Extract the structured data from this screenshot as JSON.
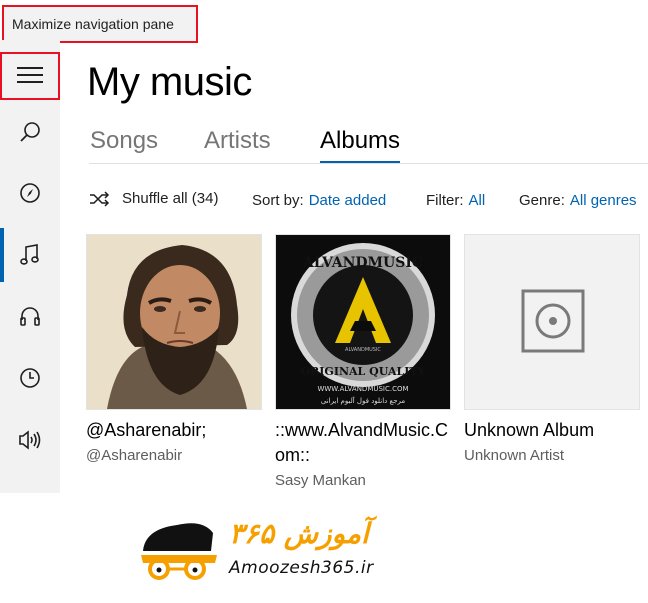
{
  "tooltip": {
    "text": "Maximize navigation pane"
  },
  "sidebar": {
    "items": [
      {
        "name": "hamburger",
        "icon": "hamburger-icon"
      },
      {
        "name": "search",
        "icon": "search-icon"
      },
      {
        "name": "explore",
        "icon": "compass-icon"
      },
      {
        "name": "my-music",
        "icon": "music-note-icon",
        "active": true
      },
      {
        "name": "recent",
        "icon": "headphones-icon"
      },
      {
        "name": "history",
        "icon": "clock-icon"
      },
      {
        "name": "now-playing",
        "icon": "speaker-icon"
      }
    ]
  },
  "header": {
    "title": "My music"
  },
  "tabs": [
    {
      "label": "Songs"
    },
    {
      "label": "Artists"
    },
    {
      "label": "Albums",
      "active": true
    }
  ],
  "toolbar": {
    "shuffle_label": "Shuffle all (34)",
    "sort_label": "Sort by:",
    "sort_value": "Date added",
    "filter_label": "Filter:",
    "filter_value": "All",
    "genre_label": "Genre:",
    "genre_value": "All genres"
  },
  "albums": [
    {
      "title": "@Asharenabir;",
      "artist": "@Asharenabir",
      "art": "portrait"
    },
    {
      "title": "::www.AlvandMusic.Com::",
      "artist": "Sasy Mankan",
      "art": "alvandmusic-logo",
      "art_text": {
        "top": "ALVANDMUSIC",
        "bottom": "ORIGINAL QUALITY",
        "brand": "ALVANDMUSIC",
        "url": "WWW.ALVANDMUSIC.COM",
        "persian": "مرجع دانلود فول آلبوم ایرانی"
      }
    },
    {
      "title": "Unknown Album",
      "artist": "Unknown Artist",
      "art": "placeholder-speaker"
    }
  ],
  "watermark": {
    "latin": "Amoozesh365.ir",
    "persian": "آموزش ۳۶۵"
  },
  "colors": {
    "accent": "#0063b1",
    "highlight": "#e81123",
    "sidebar": "#f2f2f2",
    "watermark": "#f5a000"
  }
}
